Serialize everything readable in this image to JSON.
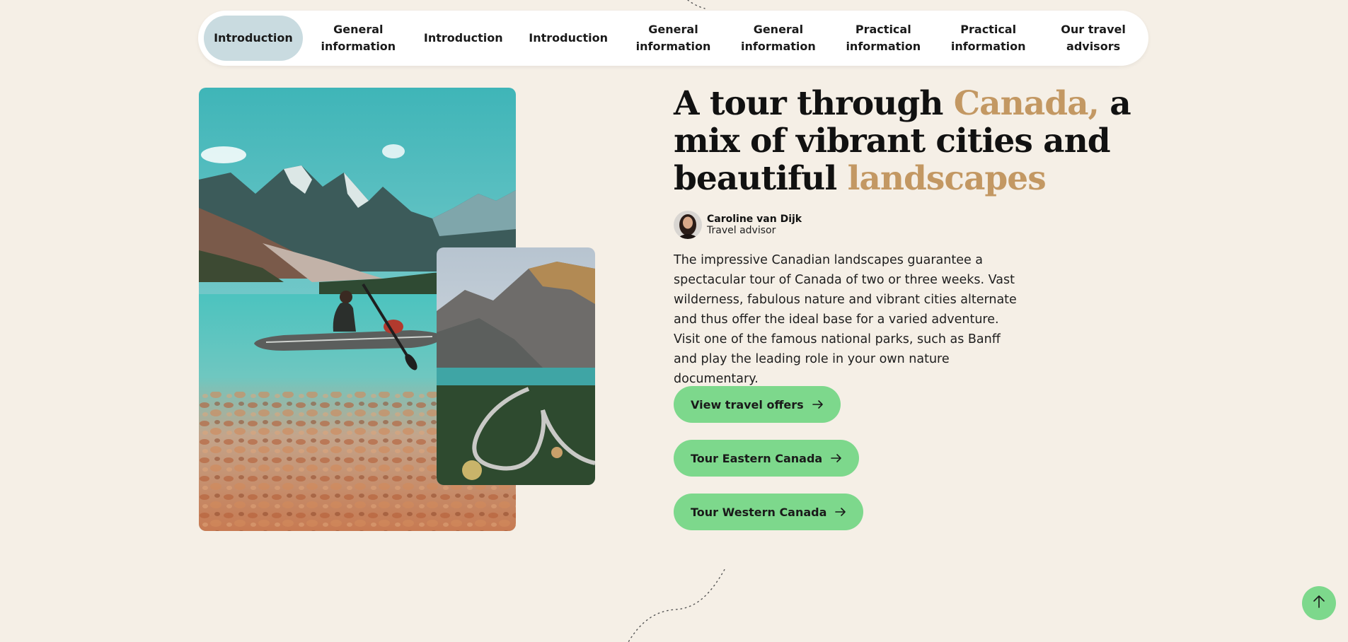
{
  "tabs": [
    {
      "label": "Introduction",
      "active": true
    },
    {
      "label": "General\ninformation",
      "active": false
    },
    {
      "label": "Introduction",
      "active": false
    },
    {
      "label": "Introduction",
      "active": false
    },
    {
      "label": "General\ninformation",
      "active": false
    },
    {
      "label": "General\ninformation",
      "active": false
    },
    {
      "label": "Practical\ninformation",
      "active": false
    },
    {
      "label": "Practical\ninformation",
      "active": false
    },
    {
      "label": "Our travel\nadvisors",
      "active": false
    }
  ],
  "hero": {
    "title_part1": "A tour through ",
    "title_accent1": "Canada,",
    "title_part2": " a mix of vibrant cities and beautiful ",
    "title_accent2": "landscapes",
    "accent_color": "#c39863"
  },
  "author": {
    "name": "Caroline van Dijk",
    "role": "Travel advisor"
  },
  "intro_text": "The impressive Canadian landscapes guarantee a spectacular tour of Canada of two or three weeks. Vast wilderness, fabulous nature and vibrant cities alternate and thus offer the ideal base for a varied adventure. Visit one of the famous national parks, such as Banff and play the leading role in your own nature documentary.",
  "buttons": {
    "view_offers": "View travel offers",
    "tour_east": "Tour Eastern Canada",
    "tour_west": "Tour Western Canada"
  },
  "colors": {
    "background": "#f5efe6",
    "active_tab": "#c9dbe0",
    "button_green": "#7dd88c"
  },
  "icons": {
    "button_arrow": "arrow-right-icon",
    "scroll_top": "arrow-up-icon"
  }
}
